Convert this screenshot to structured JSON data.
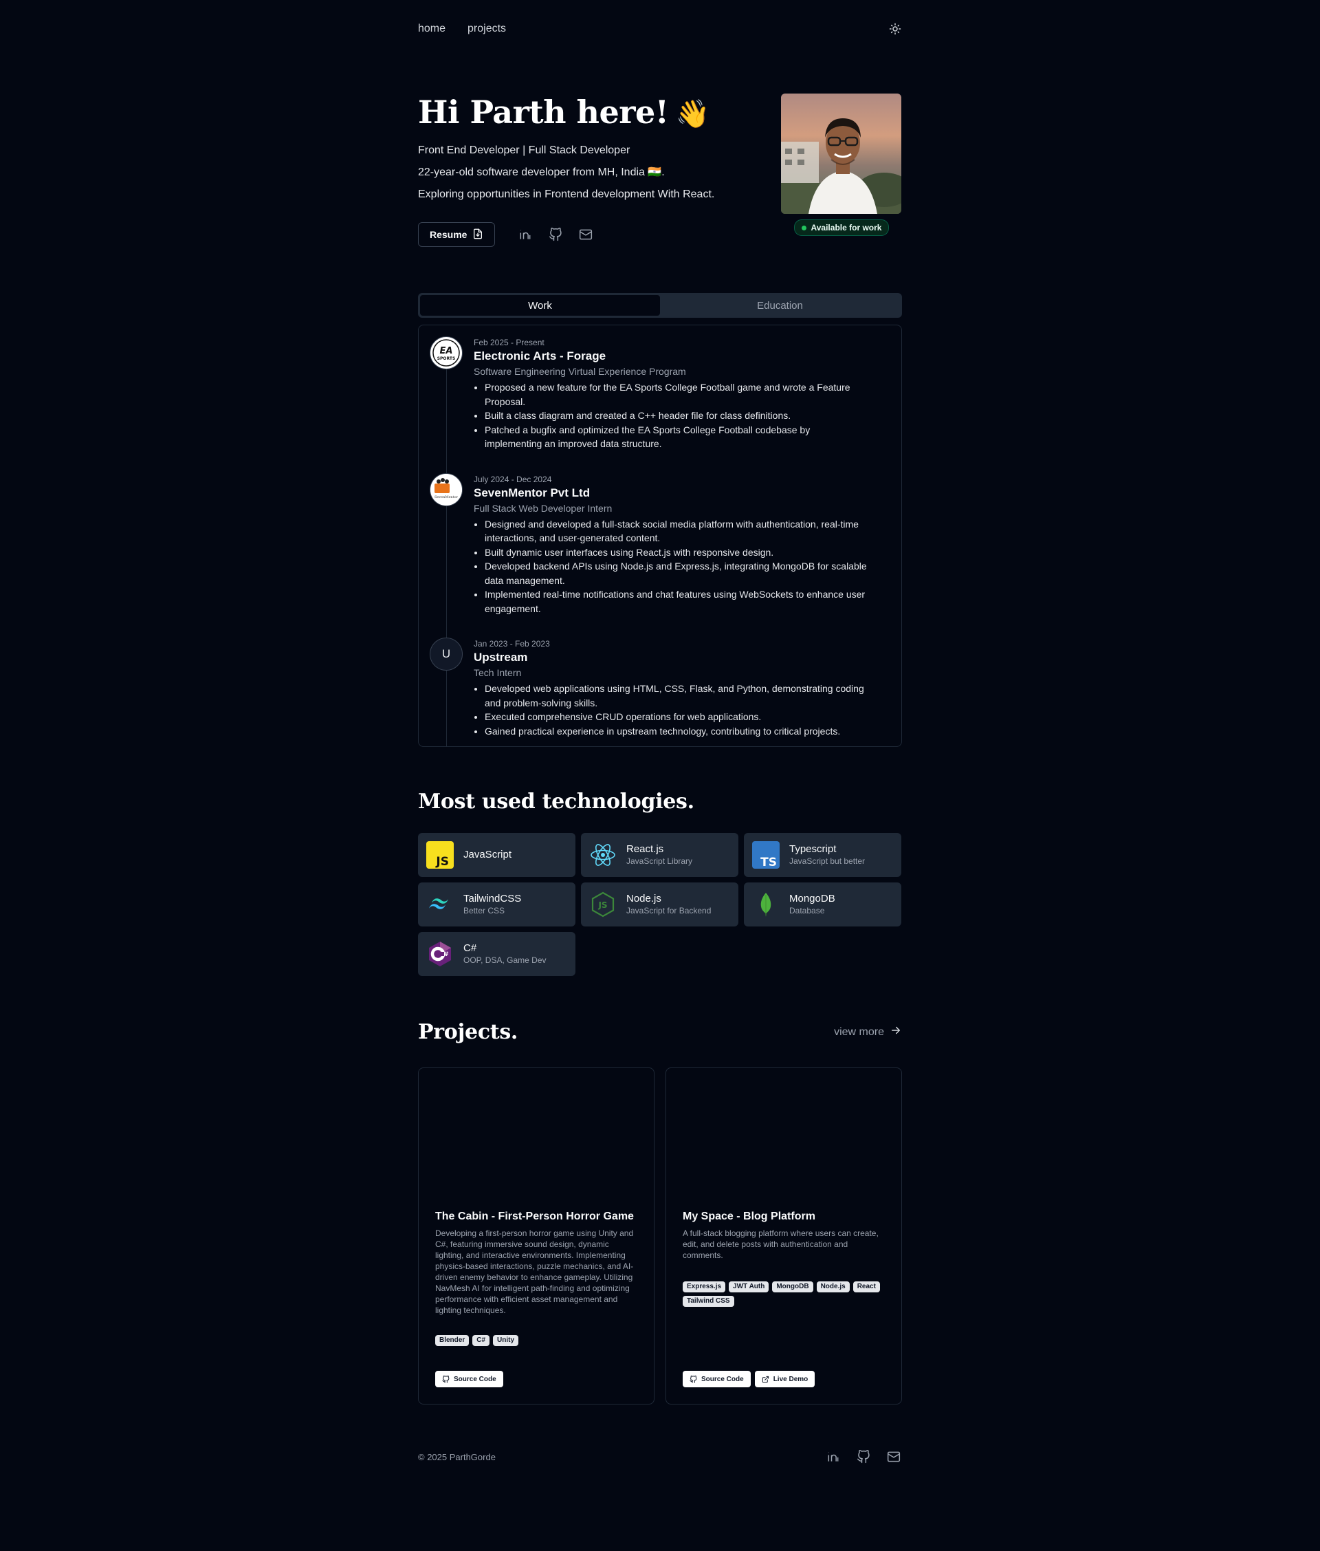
{
  "nav": {
    "home": "home",
    "projects": "projects"
  },
  "hero": {
    "title": "Hi Parth here!",
    "wave": "👋",
    "tagline": "Front End Developer | Full Stack Developer",
    "bio1": "22-year-old software developer from MH, India 🇮🇳.",
    "bio2": "Exploring opportunities in Frontend development With React.",
    "resume_label": "Resume",
    "availability": "Available for work"
  },
  "tabs": [
    "Work",
    "Education"
  ],
  "experience": [
    {
      "date": "Feb 2025 - Present",
      "company": "Electronic Arts - Forage",
      "role": "Software Engineering Virtual Experience Program",
      "logo_text": "EA SPORTS",
      "points": [
        "Proposed a new feature for the EA Sports College Football game and wrote a Feature Proposal.",
        "Built a class diagram and created a C++ header file for class definitions.",
        "Patched a bugfix and optimized the EA Sports College Football codebase by implementing an improved data structure."
      ]
    },
    {
      "date": "July 2024 - Dec 2024",
      "company": "SevenMentor Pvt Ltd",
      "role": "Full Stack Web Developer Intern",
      "logo_text": "SevenMentor",
      "points": [
        "Designed and developed a full-stack social media platform with authentication, real-time interactions, and user-generated content.",
        "Built dynamic user interfaces using React.js with responsive design.",
        "Developed backend APIs using Node.js and Express.js, integrating MongoDB for scalable data management.",
        "Implemented real-time notifications and chat features using WebSockets to enhance user engagement."
      ]
    },
    {
      "date": "Jan 2023 - Feb 2023",
      "company": "Upstream",
      "role": "Tech Intern",
      "logo_text": "U",
      "points": [
        "Developed web applications using HTML, CSS, Flask, and Python, demonstrating coding and problem-solving skills.",
        "Executed comprehensive CRUD operations for web applications.",
        "Gained practical experience in upstream technology, contributing to critical projects."
      ]
    }
  ],
  "tech": {
    "title": "Most used technologies.",
    "items": [
      {
        "name": "JavaScript",
        "desc": "",
        "icon": "javascript-icon"
      },
      {
        "name": "React.js",
        "desc": "JavaScript Library",
        "icon": "react-icon"
      },
      {
        "name": "Typescript",
        "desc": "JavaScript but better",
        "icon": "typescript-icon"
      },
      {
        "name": "TailwindCSS",
        "desc": "Better CSS",
        "icon": "tailwind-icon"
      },
      {
        "name": "Node.js",
        "desc": "JavaScript for Backend",
        "icon": "nodejs-icon"
      },
      {
        "name": "MongoDB",
        "desc": "Database",
        "icon": "mongodb-icon"
      },
      {
        "name": "C#",
        "desc": "OOP, DSA, Game Dev",
        "icon": "csharp-icon"
      }
    ]
  },
  "projects": {
    "title": "Projects.",
    "view_more": "view more",
    "items": [
      {
        "title": "The Cabin - First-Person Horror Game",
        "desc": "Developing a first-person horror game using Unity and C#, featuring immersive sound design, dynamic lighting, and interactive environments. Implementing physics-based interactions, puzzle mechanics, and AI-driven enemy behavior to enhance gameplay. Utilizing NavMesh AI for intelligent path-finding and optimizing performance with efficient asset management and lighting techniques.",
        "tags": [
          "Blender",
          "C#",
          "Unity"
        ],
        "links": [
          "Source Code"
        ]
      },
      {
        "title": "My Space - Blog Platform",
        "desc": "A full-stack blogging platform where users can create, edit, and delete posts with authentication and comments.",
        "tags": [
          "Express.js",
          "JWT Auth",
          "MongoDB",
          "Node.js",
          "React",
          "Tailwind CSS"
        ],
        "links": [
          "Source Code",
          "Live Demo"
        ]
      }
    ]
  },
  "footer": {
    "copyright": "© 2025 ParthGorde"
  },
  "colors": {
    "background": "#030712",
    "card": "#1f2937",
    "accent_green": "#22c55e"
  }
}
